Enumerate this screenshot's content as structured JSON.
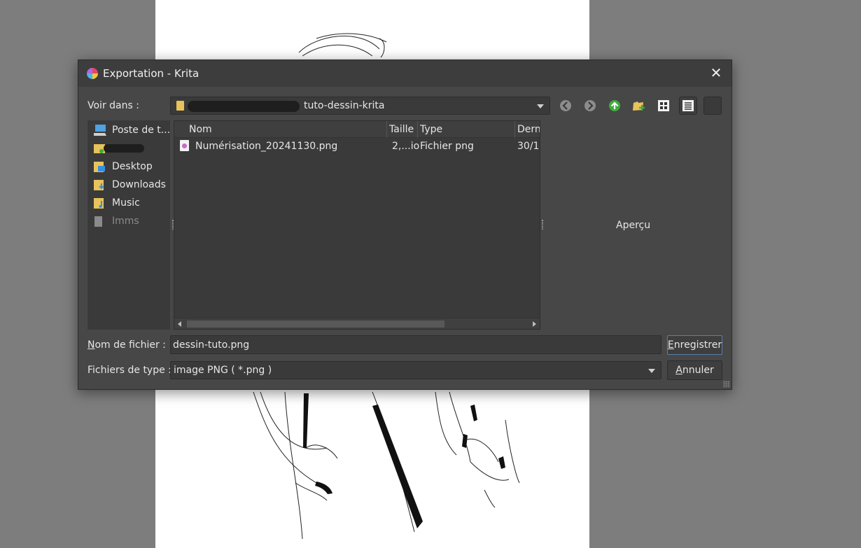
{
  "dialog": {
    "title": "Exportation - Krita",
    "look_in_label": "Voir dans :",
    "path_visible": "tuto-dessin-krita",
    "preview_label": "Aperçu",
    "filename_label_prefix": "N",
    "filename_label_rest": "om de fichier :",
    "filename_value": "dessin-tuto.png",
    "filetype_label": "Fichiers de type :",
    "filetype_value": "image PNG ( *.png )",
    "save_label_prefix": "E",
    "save_label_rest": "nregistrer",
    "cancel_label_prefix": "A",
    "cancel_label_rest": "nnuler"
  },
  "sidebar": {
    "items": [
      {
        "label": "Poste de t...",
        "icon": "computer-icon"
      },
      {
        "label": "",
        "icon": "folder-icon"
      },
      {
        "label": "Desktop",
        "icon": "folder-icon"
      },
      {
        "label": "Downloads",
        "icon": "folder-icon"
      },
      {
        "label": "Music",
        "icon": "folder-icon"
      },
      {
        "label": "Imms",
        "icon": "folder-icon"
      }
    ]
  },
  "filelist": {
    "columns": [
      "Nom",
      "Taille",
      "Type",
      "Dern"
    ],
    "rows": [
      {
        "name": "Numérisation_20241130.png",
        "size": "2,...io",
        "type": "Fichier png",
        "date": "30/1"
      }
    ]
  },
  "colors": {
    "dialog_bg": "#474747",
    "titlebar_bg": "#3d3d3d",
    "panel_bg": "#3a3a3a",
    "folder": "#e8c25a",
    "nav_up_green": "#3cae3c"
  }
}
